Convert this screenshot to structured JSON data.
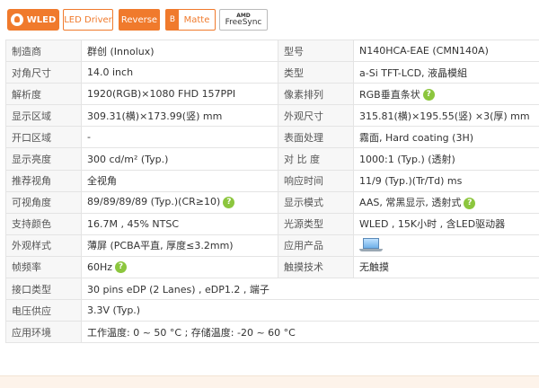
{
  "badges": {
    "wled": "WLED",
    "led_driver": "LED Driver",
    "reverse": "Reverse",
    "matte_letter": "B",
    "matte": "Matte",
    "amd": "AMD",
    "freesync": "FreeSync"
  },
  "rows": [
    {
      "k1": "制造商",
      "v1": "群创 (Innolux)",
      "k2": "型号",
      "v2": "N140HCA-EAE (CMN140A)"
    },
    {
      "k1": "对角尺寸",
      "v1": "14.0 inch",
      "k2": "类型",
      "v2": "a-Si TFT-LCD, 液晶模組"
    },
    {
      "k1": "解析度",
      "v1": "1920(RGB)×1080   FHD   157PPI",
      "k2": "像素排列",
      "v2": "RGB垂直条状"
    },
    {
      "k1": "显示区域",
      "v1": "309.31(横)×173.99(竖) mm",
      "k2": "外观尺寸",
      "v2": "315.81(横)×195.55(竖) ×3(厚) mm"
    },
    {
      "k1": "开口区域",
      "v1": "-",
      "k2": "表面处理",
      "v2": "霧面, Hard coating (3H)"
    },
    {
      "k1": "显示亮度",
      "v1": "300 cd/m² (Typ.)",
      "k2": "对 比 度",
      "v2": "1000:1 (Typ.) (透射)"
    },
    {
      "k1": "推荐视角",
      "v1": "全视角",
      "k2": "响应时间",
      "v2": "11/9 (Typ.)(Tr/Td) ms"
    },
    {
      "k1": "可视角度",
      "v1": "89/89/89/89 (Typ.)(CR≥10)",
      "k2": "显示模式",
      "v2": "AAS, 常黑显示, 透射式"
    },
    {
      "k1": "支持颜色",
      "v1": "16.7M , 45% NTSC",
      "k2": "光源类型",
      "v2": "WLED , 15K小时 , 含LED驱动器"
    },
    {
      "k1": "外观样式",
      "v1": "薄屏 (PCBA平直, 厚度≤3.2mm)",
      "k2": "应用产品",
      "v2": ""
    },
    {
      "k1": "帧频率",
      "v1": "60Hz",
      "k2": "触摸技术",
      "v2": "无触摸"
    },
    {
      "k1": "接口类型",
      "v1": "30 pins   eDP (2 Lanes) , eDP1.2 , 端子"
    },
    {
      "k1": "电压供应",
      "v1": "3.3V (Typ.)"
    },
    {
      "k1": "应用环境",
      "v1": "工作温度: 0 ~ 50 °C ; 存储温度: -20 ~ 60 °C"
    }
  ],
  "help_mark": "?",
  "colors": {
    "accent": "#f07a2c",
    "help": "#8cc63e",
    "label_bg": "#f7f7f7",
    "border": "#e4e4e4"
  }
}
